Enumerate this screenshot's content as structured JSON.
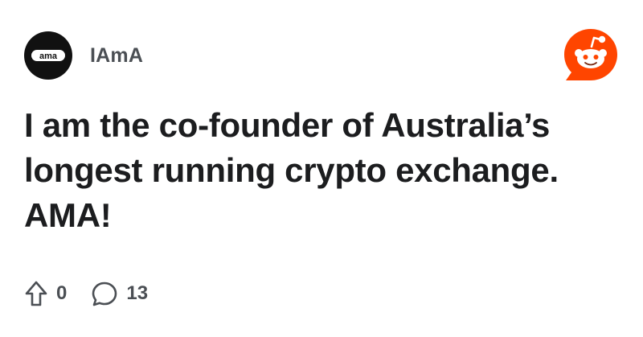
{
  "subreddit": {
    "name": "IAmA",
    "avatar_icon": "ama-logo-icon",
    "avatar_color": "#111111"
  },
  "brand": {
    "icon": "reddit-logo-icon",
    "color": "#FF4500"
  },
  "post": {
    "title": "I am the co-founder of Australia’s longest running crypto exchange. AMA!"
  },
  "stats": {
    "upvote_icon": "upvote-arrow-icon",
    "upvotes": "0",
    "comment_icon": "comment-bubble-icon",
    "comments": "13"
  }
}
